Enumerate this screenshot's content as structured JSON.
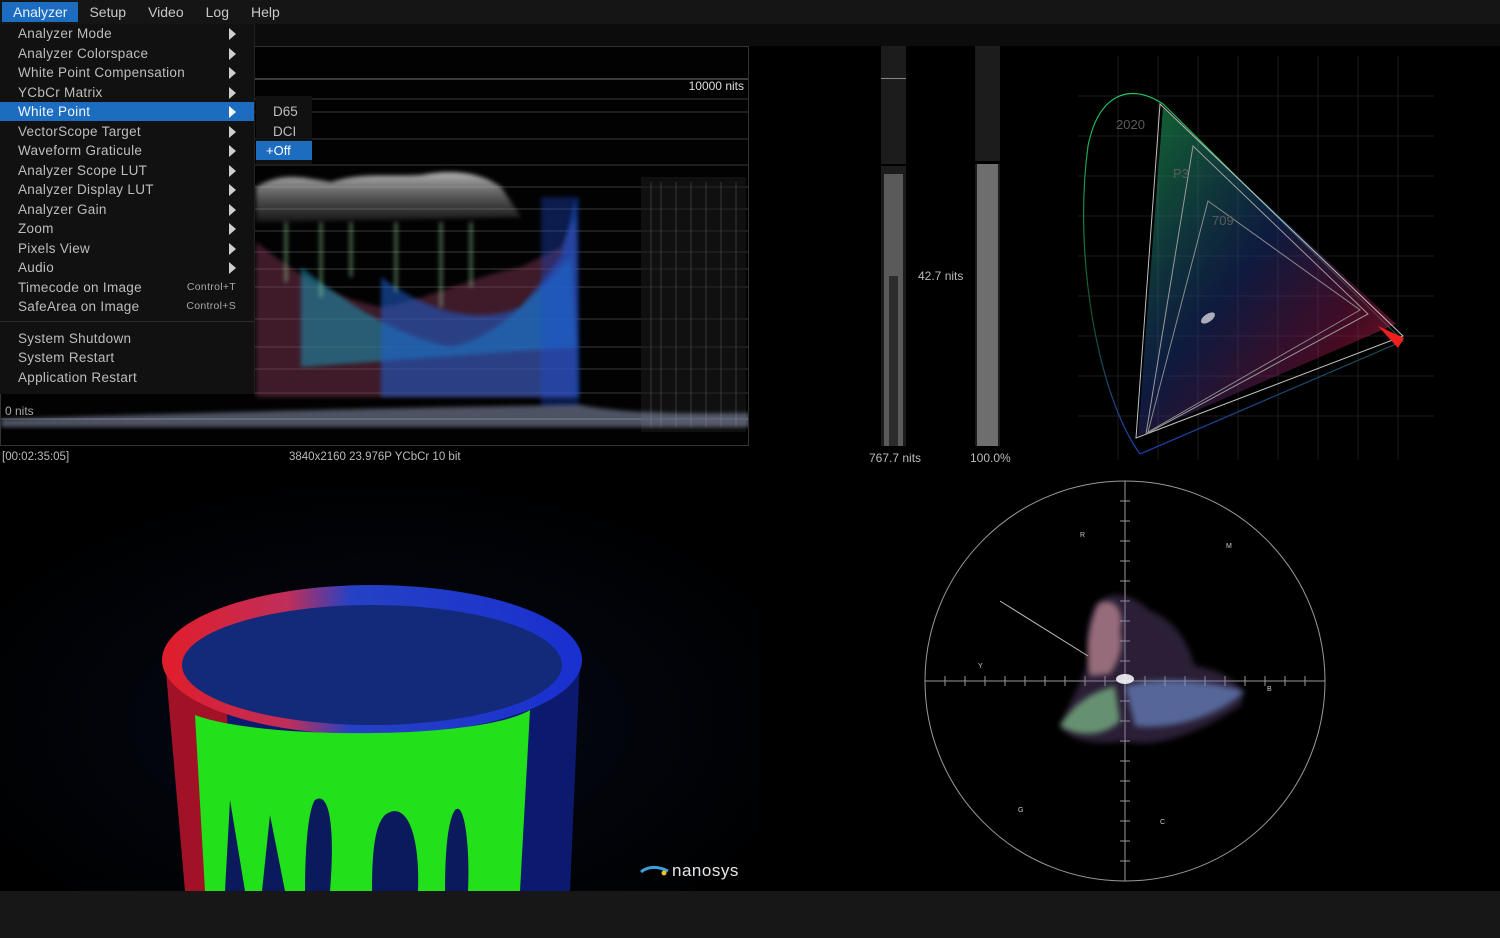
{
  "menubar": {
    "items": [
      "Analyzer",
      "Setup",
      "Video",
      "Log",
      "Help"
    ]
  },
  "analyzer_menu": {
    "items": [
      {
        "label": "Analyzer Mode",
        "submenu": true
      },
      {
        "label": "Analyzer Colorspace",
        "submenu": true
      },
      {
        "label": "White Point Compensation",
        "submenu": true
      },
      {
        "label": "YCbCr Matrix",
        "submenu": true
      },
      {
        "label": "White Point",
        "submenu": true,
        "selected": true
      },
      {
        "label": "VectorScope Target",
        "submenu": true
      },
      {
        "label": "Waveform Graticule",
        "submenu": true
      },
      {
        "label": "Analyzer Scope LUT",
        "submenu": true
      },
      {
        "label": "Analyzer Display LUT",
        "submenu": true
      },
      {
        "label": "Analyzer Gain",
        "submenu": true
      },
      {
        "label": "Zoom",
        "submenu": true
      },
      {
        "label": "Pixels View",
        "submenu": true
      },
      {
        "label": "Audio",
        "submenu": true
      },
      {
        "label": "Timecode on Image",
        "shortcut": "Control+T"
      },
      {
        "label": "SafeArea on Image",
        "shortcut": "Control+S"
      },
      {
        "label": "System Shutdown"
      },
      {
        "label": "System Restart"
      },
      {
        "label": "Application Restart"
      }
    ]
  },
  "white_point_submenu": {
    "items": [
      "D65",
      "DCI",
      "+Off"
    ],
    "selected": "+Off"
  },
  "waveform": {
    "max_label": "10000 nits",
    "min_label": "0 nits"
  },
  "status": {
    "timecode": "[00:02:35:05]",
    "format": "3840x2160 23.976P YCbCr 10 bit"
  },
  "meters": {
    "left_value": "767.7 nits",
    "mid_value": "42.7 nits",
    "right_value": "100.0%",
    "left_level": 0.68,
    "right_level": 0.71
  },
  "cie": {
    "labels": [
      "2020",
      "P3",
      "709"
    ]
  },
  "vectorscope": {
    "targets": [
      "R",
      "M",
      "Y",
      "B",
      "G",
      "C"
    ]
  },
  "logo": {
    "text": "nanosys"
  },
  "colors": {
    "menu_highlight": "#1c6dbf",
    "background": "#000000",
    "menubar": "#151515"
  }
}
